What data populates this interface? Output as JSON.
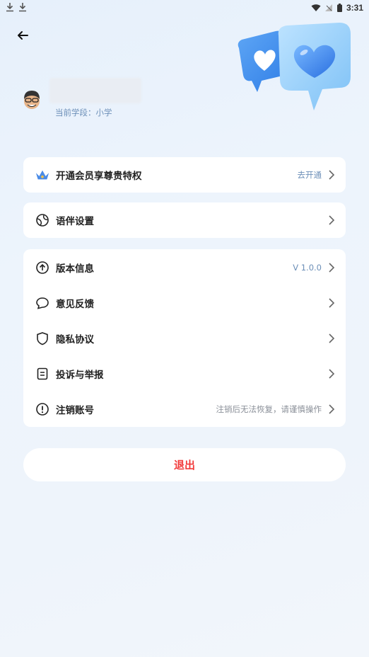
{
  "status_bar": {
    "time": "3:31"
  },
  "profile": {
    "stage_text": "当前学段：小学"
  },
  "vip": {
    "label": "开通会员享尊贵特权",
    "action": "去开通"
  },
  "companion": {
    "label": "语伴设置"
  },
  "menu": {
    "version": {
      "label": "版本信息",
      "value": "V 1.0.0"
    },
    "feedback": {
      "label": "意见反馈"
    },
    "privacy": {
      "label": "隐私协议"
    },
    "report": {
      "label": "投诉与举报"
    },
    "cancel": {
      "label": "注销账号",
      "value": "注销后无法恢复，请谨慎操作"
    }
  },
  "logout": {
    "label": "退出"
  },
  "colors": {
    "accent": "#4a8be6",
    "danger": "#f23b3b",
    "link": "#6c8fb8"
  },
  "icons": [
    "download-icon",
    "wifi-icon",
    "signal-icon",
    "battery-icon",
    "back-arrow-icon",
    "crown-icon",
    "globe-icon",
    "arrow-up-circle-icon",
    "chat-bubble-icon",
    "shield-icon",
    "document-icon",
    "alert-circle-icon",
    "chevron-right-icon"
  ]
}
